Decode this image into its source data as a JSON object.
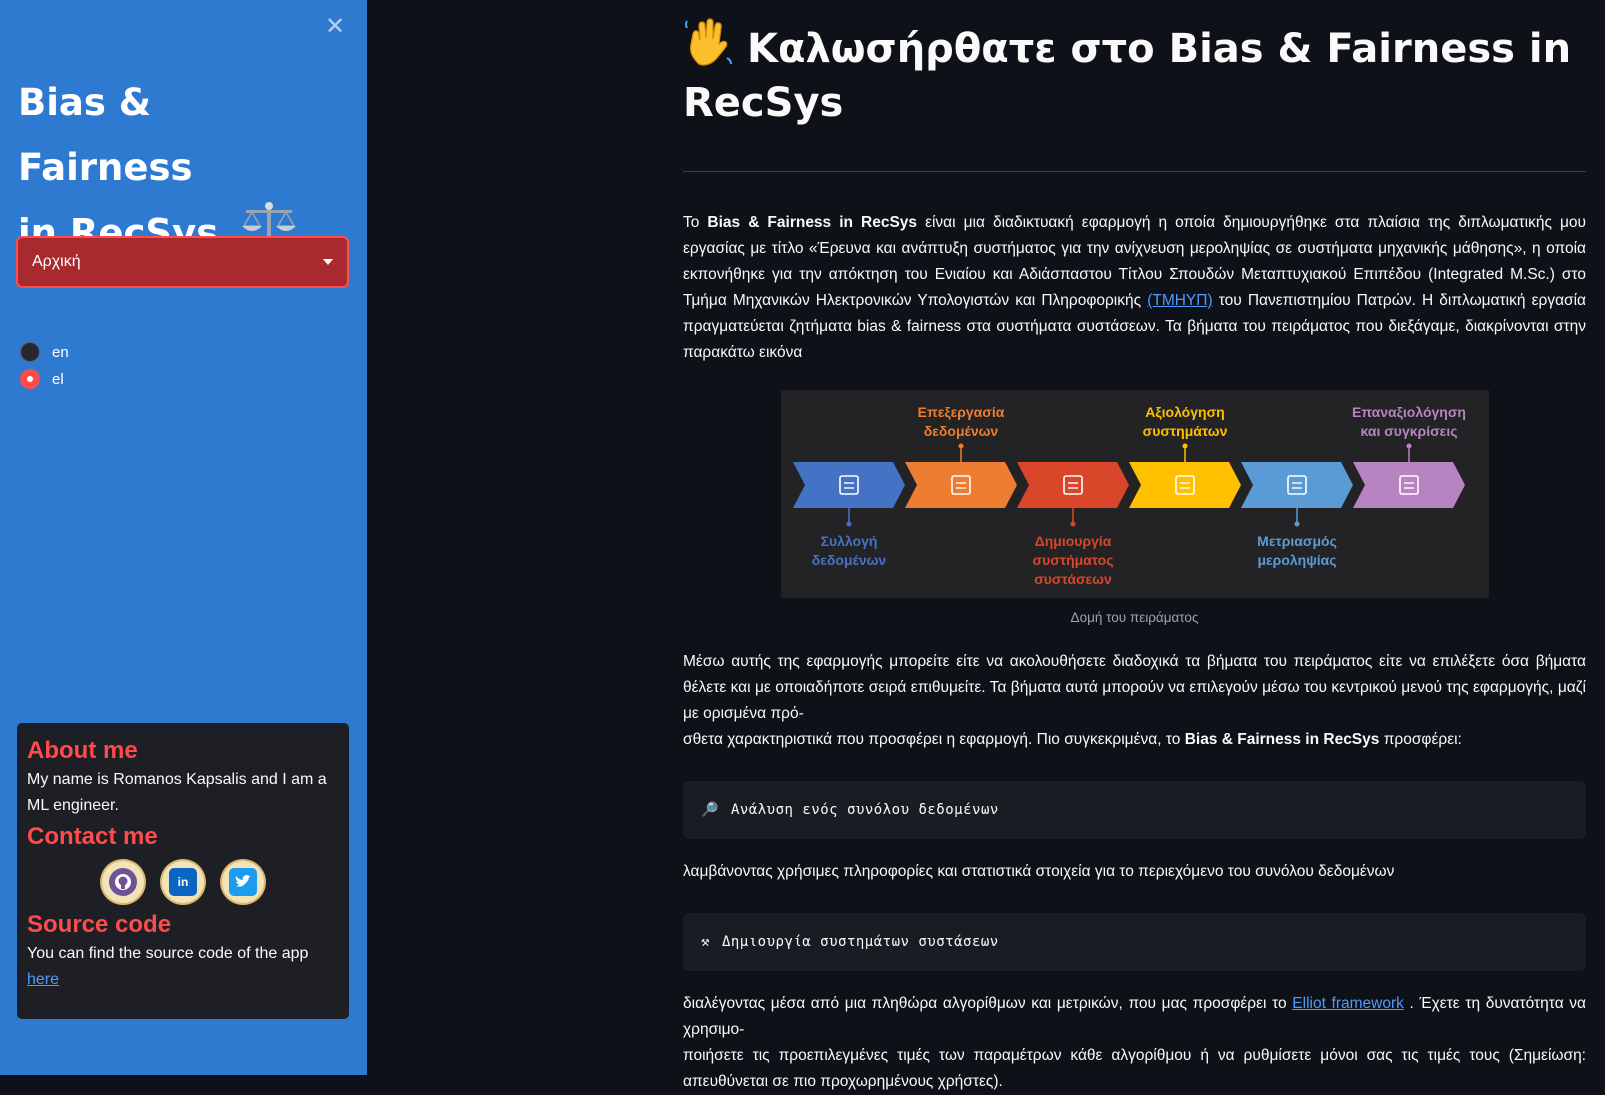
{
  "sidebar": {
    "title_line1": "Bias & Fairness",
    "title_line2": "in RecSys",
    "nav_select": {
      "value": "Αρχική"
    },
    "languages": [
      {
        "label": "en",
        "selected": false
      },
      {
        "label": "el",
        "selected": true
      }
    ],
    "about": {
      "heading": "About me",
      "text": "My name is Romanos Kapsalis and I am a ML engineer."
    },
    "contact": {
      "heading": "Contact me",
      "badges": [
        "github-icon",
        "linkedin-icon",
        "twitter-icon"
      ]
    },
    "source": {
      "heading": "Source code",
      "text": "You can find the source code of the app",
      "link": "here"
    }
  },
  "main": {
    "title": "Καλωσήρθατε στο Bias & Fairness in RecSys",
    "intro": {
      "p1": "Το ",
      "bold1": "Bias & Fairness in RecSys",
      "p2": " είναι μια διαδικτυακή εφαρμογή η οποία δημιουργήθηκε στα πλαίσια της διπλωματικής μου εργασίας με τίτλο «Έρευνα και ανάπτυξη συστήματος για την ανίχνευση μεροληψίας σε συστήματα μηχανικής μάθησης», η οποία εκπονήθηκε για την απόκτηση του Ενιαίου και Αδιάσπαστου Τίτλου Σπουδών Μεταπτυχιακού Επιπέδου (Integrated M.Sc.) στο Τμήμα Μηχανικών Ηλεκτρονικών Υπολογιστών και Πληροφορικής ",
      "link": "(ΤΜΗΥΠ)",
      "p3": " του Πανεπιστημίου Πατρών. Η διπλωματική εργασία πραγματεύεται ζητήματα bias & fairness στα συστήματα συστάσεων. Τα βήματα του πειράματος που διεξάγαμε, διακρίνονται στην παρακάτω εικόνα"
    },
    "figure": {
      "caption": "Δομή του πειράματος",
      "steps": [
        {
          "label_l1": "Συλλογή",
          "label_l2": "δεδομένων",
          "label_l3": "",
          "color": "#4472c4",
          "label_color": "#4472c4",
          "icon": "document-icon"
        },
        {
          "label_l1": "Επεξεργασία",
          "label_l2": "δεδομένων",
          "label_l3": "",
          "color": "#ed7d31",
          "label_color": "#ed7d31",
          "icon": "code-window-icon"
        },
        {
          "label_l1": "Δημιουργία",
          "label_l2": "συστήματος",
          "label_l3": "συστάσεων",
          "color": "#d9462a",
          "label_color": "#d9462a",
          "icon": "layers-icon"
        },
        {
          "label_l1": "Αξιολόγηση",
          "label_l2": "συστημάτων",
          "label_l3": "",
          "color": "#ffc000",
          "label_color": "#ffc000",
          "icon": "chart-board-icon"
        },
        {
          "label_l1": "Μετριασμός",
          "label_l2": "μεροληψίας",
          "label_l3": "",
          "color": "#5b9bd5",
          "label_color": "#5b9bd5",
          "icon": "balance-scale-icon"
        },
        {
          "label_l1": "Επαναξιολόγηση",
          "label_l2": "και συγκρίσεις",
          "label_l3": "",
          "color": "#b784c1",
          "label_color": "#b784c1",
          "icon": "microscope-icon"
        }
      ]
    },
    "para2": {
      "p1": "Μέσω αυτής της εφαρμογής μπορείτε είτε να ακολουθήσετε διαδοχικά τα βήματα του πειράματος είτε να επιλέξετε όσα βήματα θέλετε και με οποιαδήποτε σειρά επιθυμείτε. Τα βήματα αυτά μπορούν να επιλεγούν μέσω του κεντρικού μενού της εφαρμογής, μαζί με ορισμένα πρό-",
      "p2": "σθετα χαρακτηριστικά που προσφέρει η εφαρμογή. Πιο συγκεκριμένα, το ",
      "bold": "Bias & Fairness in RecSys",
      "p3": " προσφέρει:"
    },
    "feature1": {
      "icon_glyph": "🔎",
      "label": "Ανάλυση ενός συνόλου δεδομένων"
    },
    "feature1_desc": "λαμβάνοντας χρήσιμες πληροφορίες και στατιστικά στοιχεία για το περιεχόμενο του συνόλου δεδομένων",
    "feature2": {
      "icon_glyph": "⚒",
      "label": "Δημιουργία συστημάτων συστάσεων"
    },
    "feature2_desc": {
      "p1": "διαλέγοντας μέσα από μια πληθώρα αλγορίθμων και μετρικών, που μας προσφέρει το ",
      "link": "Elliot framework",
      "p2": " . Έχετε τη δυνατότητα να χρησιμο-",
      "p3": "ποιήσετε τις προεπιλεγμένες τιμές των παραμέτρων κάθε αλγορίθμου ή να ρυθμίσετε μόνοι σας τις τιμές τους (Σημείωση: απευθύνεται σε πιο προχωρημένους χρήστες)."
    }
  },
  "colors": {
    "sidebar": "#2f7ad1",
    "accent": "#ff4b4b",
    "background": "#0e1117",
    "link": "#4d9bff"
  }
}
